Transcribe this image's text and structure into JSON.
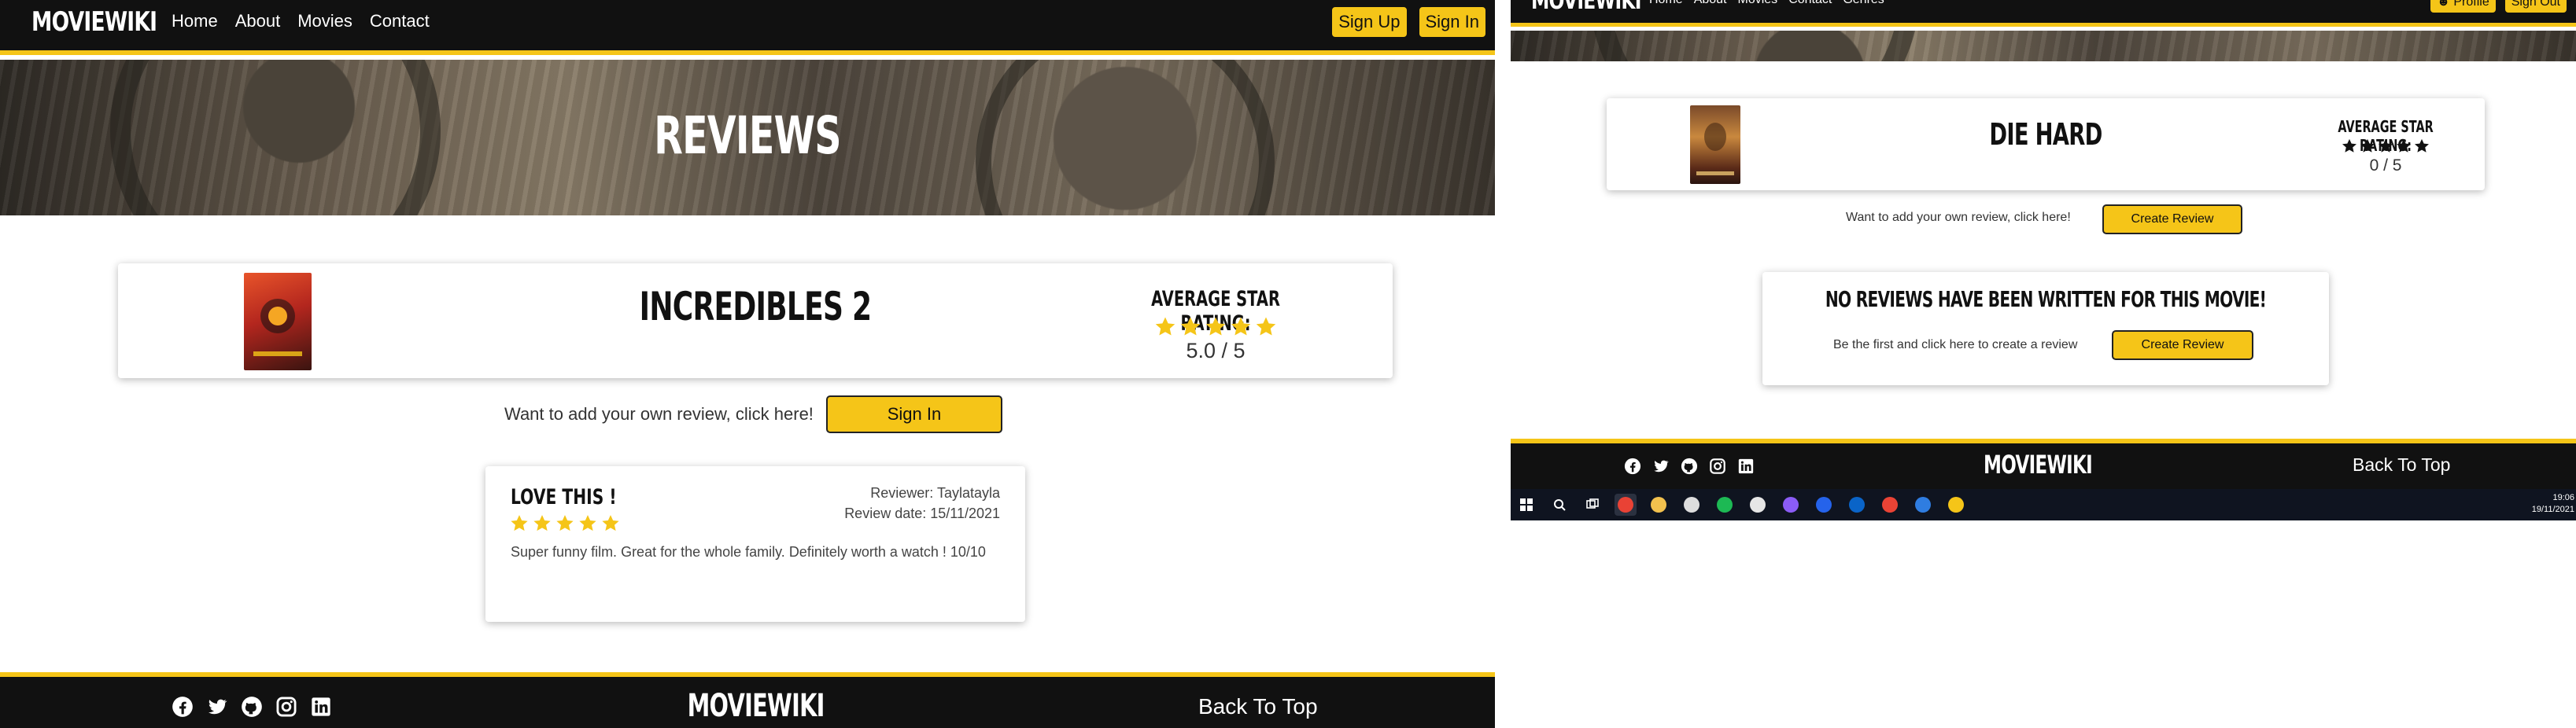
{
  "left": {
    "nav": {
      "brand": "MOVIEWIKI",
      "links": [
        "Home",
        "About",
        "Movies",
        "Contact"
      ],
      "signup": "Sign Up",
      "signin": "Sign In"
    },
    "hero_title": "REVIEWS",
    "movie": {
      "title": "INCREDIBLES 2",
      "avg_label": "AVERAGE STAR RATING:",
      "rating_text": "5.0 / 5",
      "stars_filled": 5
    },
    "cta_text": "Want to add your own review, click here!",
    "cta_button": "Sign In",
    "review": {
      "title": "LOVE THIS !",
      "stars_filled": 5,
      "reviewer": "Reviewer: Taylatayla",
      "date": "Review date: 15/11/2021",
      "body": "Super funny film. Great for the whole family. Definitely worth a watch ! 10/10"
    },
    "footer": {
      "brand": "MOVIEWIKI",
      "back_to_top": "Back To Top"
    }
  },
  "right": {
    "nav": {
      "brand": "MOVIEWIKI",
      "links": [
        "Home",
        "About",
        "Movies",
        "Contact",
        "Genres"
      ],
      "profile": "Profile",
      "signout": "Sign Out"
    },
    "movie": {
      "title": "DIE HARD",
      "avg_label": "AVERAGE STAR RATING:",
      "rating_text": "0 / 5",
      "stars_filled": 0
    },
    "cta_text": "Want to add your own review, click here!",
    "cta_button": "Create Review",
    "no_reviews": {
      "title": "NO REVIEWS HAVE BEEN WRITTEN FOR THIS MOVIE!",
      "text": "Be the first and click here to create a review",
      "button": "Create Review"
    },
    "footer": {
      "brand": "MOVIEWIKI",
      "back_to_top": "Back To Top"
    },
    "taskbar": {
      "time": "19:06",
      "date": "19/11/2021",
      "icons": [
        "windows-start-icon",
        "search-icon",
        "task-view-icon",
        "chrome-icon",
        "file-explorer-icon",
        "store-icon",
        "spotify-icon",
        "app-icon",
        "messenger-icon",
        "app-blue-icon",
        "outlook-icon",
        "gmail-icon",
        "todo-icon",
        "sticky-notes-icon"
      ]
    }
  },
  "colors": {
    "accent": "#f5c518",
    "dark": "#111111"
  },
  "social_icons": [
    "facebook-icon",
    "twitter-icon",
    "github-icon",
    "instagram-icon",
    "linkedin-icon"
  ]
}
